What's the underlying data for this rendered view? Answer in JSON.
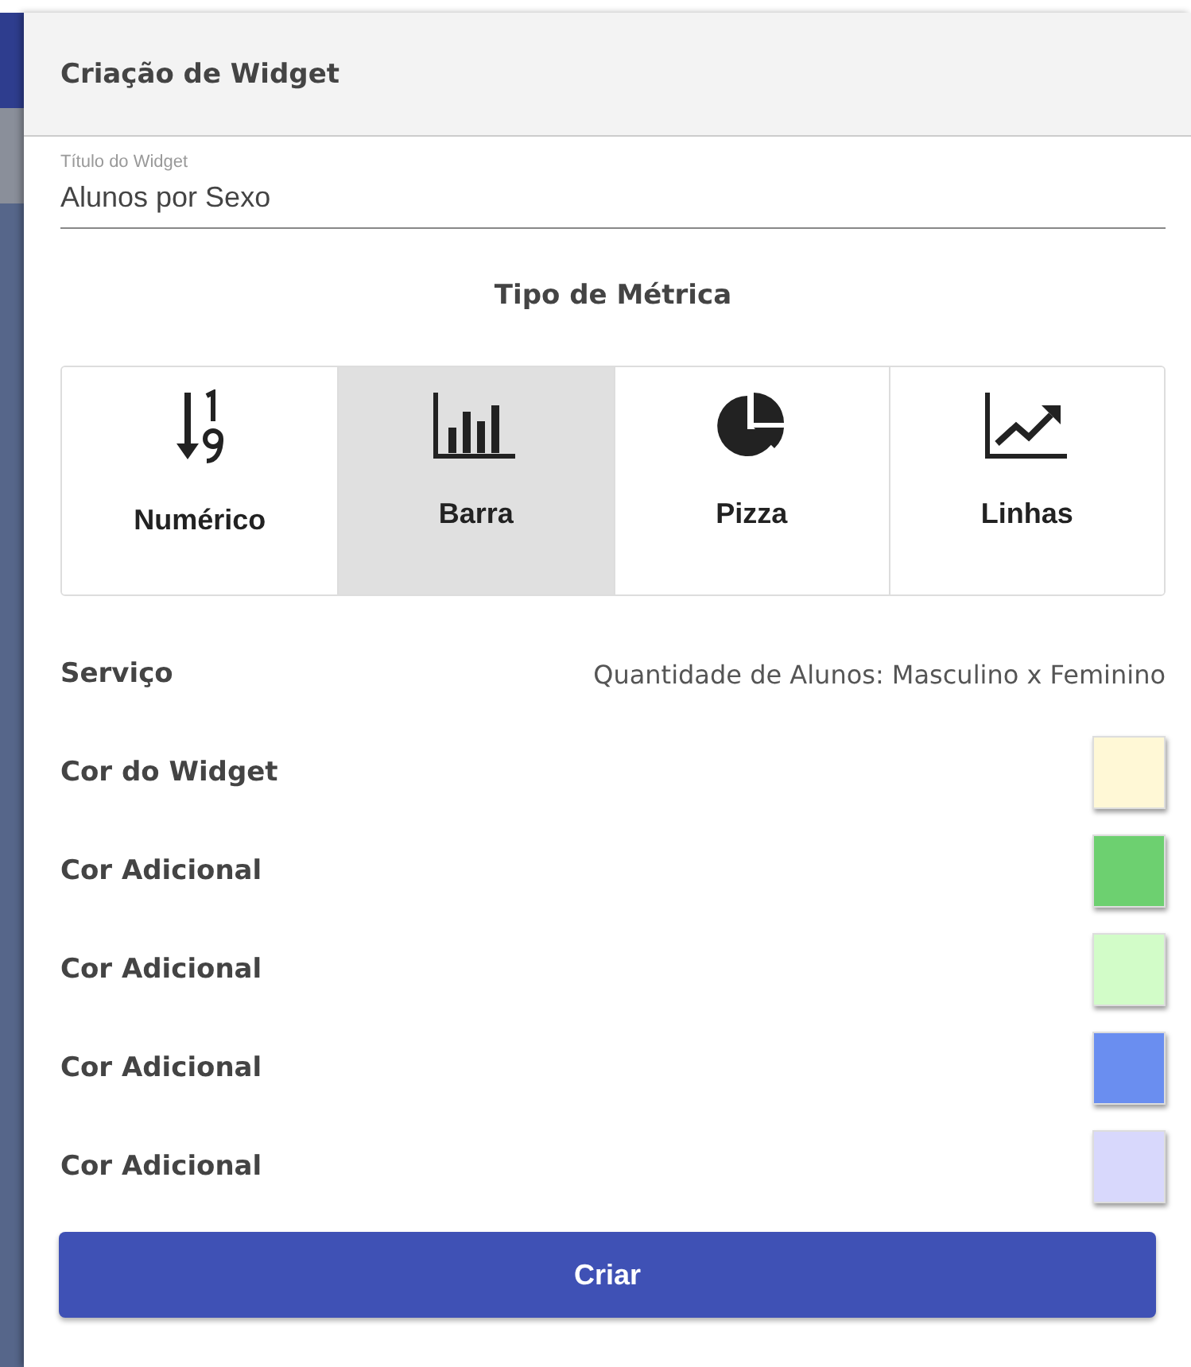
{
  "dialog": {
    "title": "Criação de Widget"
  },
  "title_field": {
    "label": "Título do Widget",
    "value": "Alunos por Sexo"
  },
  "metric_type": {
    "heading": "Tipo de Métrica",
    "options": [
      {
        "kind": "numeric",
        "label": "Numérico",
        "selected": false
      },
      {
        "kind": "bar",
        "label": "Barra",
        "selected": true
      },
      {
        "kind": "pie",
        "label": "Pizza",
        "selected": false
      },
      {
        "kind": "line",
        "label": "Linhas",
        "selected": false
      }
    ]
  },
  "service": {
    "label": "Serviço",
    "value": "Quantidade de Alunos: Masculino x Feminino"
  },
  "colors": [
    {
      "label": "Cor do Widget",
      "color": "#fff8d6"
    },
    {
      "label": "Cor Adicional",
      "color": "#6dd070"
    },
    {
      "label": "Cor Adicional",
      "color": "#d2fcc8"
    },
    {
      "label": "Cor Adicional",
      "color": "#6a8ef0"
    },
    {
      "label": "Cor Adicional",
      "color": "#d8d8fc"
    }
  ],
  "submit_button": "Criar"
}
